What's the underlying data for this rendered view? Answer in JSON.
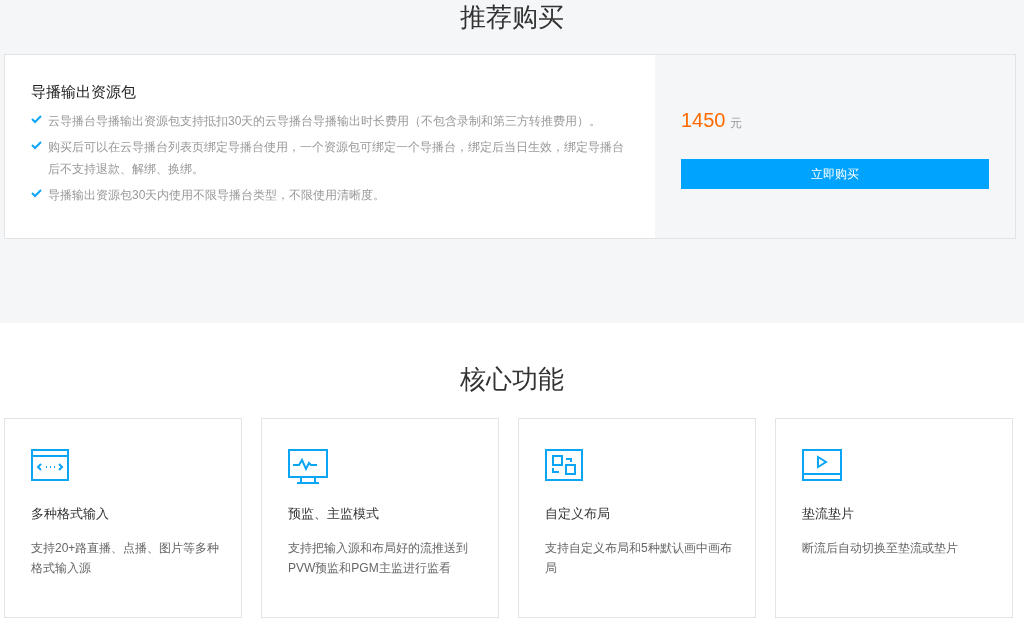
{
  "recommend": {
    "title": "推荐购买",
    "package": {
      "name": "导播输出资源包",
      "features": [
        "云导播台导播输出资源包支持抵扣30天的云导播台导播输出时长费用（不包含录制和第三方转推费用）。",
        "购买后可以在云导播台列表页绑定导播台使用，一个资源包可绑定一个导播台，绑定后当日生效，绑定导播台后不支持退款、解绑、换绑。",
        "导播输出资源包30天内使用不限导播台类型，不限使用清晰度。"
      ],
      "price": "1450",
      "unit": "元",
      "buy_button": "立即购买"
    }
  },
  "core": {
    "title": "核心功能",
    "cards": [
      {
        "kind": "code",
        "title": "多种格式输入",
        "desc": "支持20+路直播、点播、图片等多种格式输入源"
      },
      {
        "kind": "monitor",
        "title": "预监、主监模式",
        "desc": "支持把输入源和布局好的流推送到PVW预监和PGM主监进行监看"
      },
      {
        "kind": "layout",
        "title": "自定义布局",
        "desc": "支持自定义布局和5种默认画中画布局"
      },
      {
        "kind": "play",
        "title": "垫流垫片",
        "desc": "断流后自动切换至垫流或垫片"
      }
    ]
  }
}
